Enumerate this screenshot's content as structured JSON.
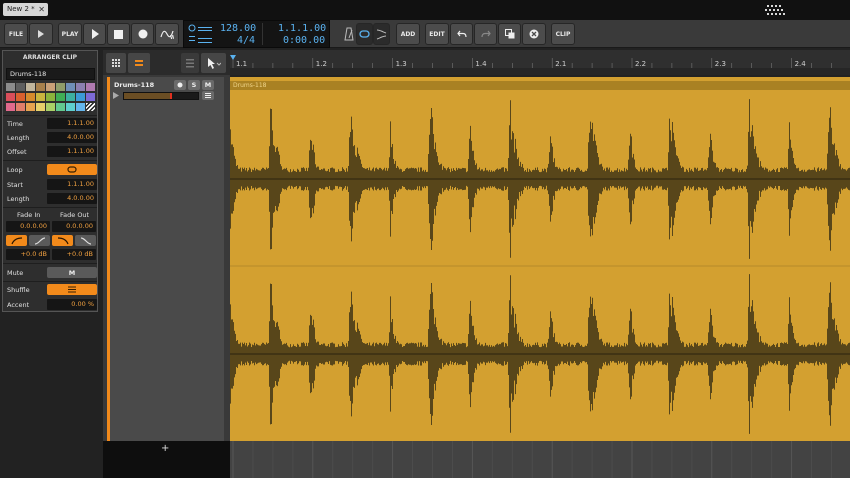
{
  "window": {
    "doc_tab": "New 2 *"
  },
  "toolbar": {
    "file_label": "FILE",
    "play_label": "PLAY",
    "tempo": "128.00",
    "time_signature": "4/4",
    "position_bars": "1.1.1.00",
    "position_time": "0:00.00",
    "add_label": "ADD",
    "edit_label": "EDIT",
    "clip_label": "CLIP"
  },
  "inspector": {
    "title": "ARRANGER CLIP",
    "clip_name": "Drums-118",
    "time_label": "Time",
    "time_value": "1.1.1.00",
    "length_label": "Length",
    "length_value": "4.0.0.00",
    "offset_label": "Offset",
    "offset_value": "1.1.1.00",
    "loop_label": "Loop",
    "start_label": "Start",
    "start_value": "1.1.1.00",
    "loop_length_label": "Length",
    "loop_length_value": "4.0.0.00",
    "fade_in_label": "Fade In",
    "fade_out_label": "Fade Out",
    "fade_in_value": "0.0.0.00",
    "fade_out_value": "0.0.0.00",
    "fade_in_gain": "+0.0 dB",
    "fade_out_gain": "+0.0 dB",
    "mute_label": "Mute",
    "mute_button": "M",
    "shuffle_label": "Shuffle",
    "accent_label": "Accent",
    "accent_value": "0.00 %"
  },
  "track": {
    "name": "Drums-118",
    "solo": "S",
    "mute": "M",
    "add_symbol": "+"
  },
  "clip": {
    "name": "Drums-118",
    "color": "#d3a030"
  },
  "ruler": {
    "marks": [
      "1.1",
      "1.2",
      "1.3",
      "1.4",
      "2.1",
      "2.2",
      "2.3",
      "2.4"
    ]
  },
  "colors": {
    "accent": "#f28a1b",
    "lcd": "#5ab2f0",
    "clip": "#d3a030",
    "waveform": "#3a3016"
  },
  "swatches": [
    "#8c8c8c",
    "#5f5f5f",
    "#c2b69c",
    "#a8804b",
    "#c9a077",
    "#8f9d6a",
    "#6f8fb8",
    "#8c7fb0",
    "#b07ab0",
    "#d94e5a",
    "#d9602e",
    "#d68b2c",
    "#c9b53e",
    "#8bb43c",
    "#3fae55",
    "#3cb0a0",
    "#3c9ad6",
    "#7d6ad6",
    "#e0698c",
    "#e07e6a",
    "#e6a34f",
    "#e6d06a",
    "#a9d067",
    "#62c990",
    "#5ecfcf",
    "#64b6ee",
    "#ffffff"
  ]
}
